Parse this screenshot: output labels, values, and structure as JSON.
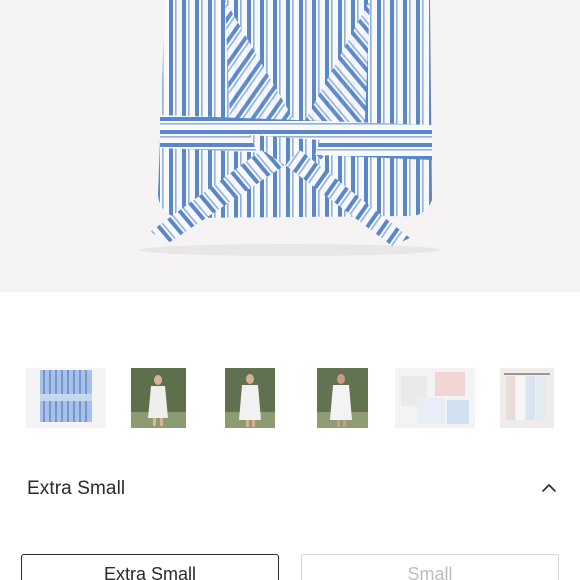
{
  "product": {
    "main_image": "blue-white-striped-seersucker-robe-folded",
    "thumbnails": [
      {
        "name": "robe-folded-view"
      },
      {
        "name": "robe-model-front-view"
      },
      {
        "name": "robe-model-standing-view"
      },
      {
        "name": "robe-model-side-view"
      },
      {
        "name": "robes-colors-flatlay-view"
      },
      {
        "name": "robes-on-rack-view"
      }
    ]
  },
  "size_selector": {
    "selected_label": "Extra Small",
    "expanded": true,
    "options": [
      {
        "label": "Extra Small",
        "selected": true
      },
      {
        "label": "Small",
        "selected": false
      }
    ]
  },
  "colors": {
    "stripe_blue": "#5b87c9",
    "selected_border": "#2a2a2a",
    "unselected_border": "#d6d6d6",
    "unselected_text": "#bdbdbd"
  }
}
